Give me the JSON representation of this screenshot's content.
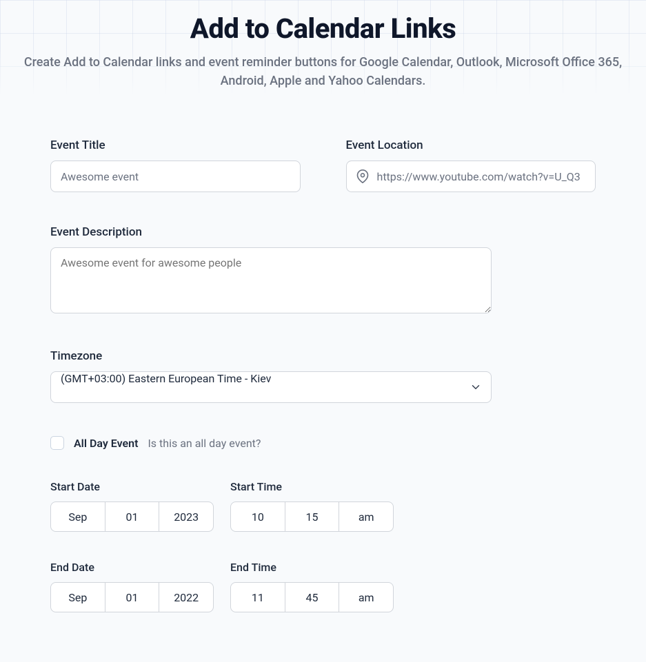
{
  "header": {
    "title": "Add to Calendar Links",
    "subtitle": "Create Add to Calendar links and event reminder buttons for Google Calendar, Outlook, Microsoft Office 365, Android, Apple and Yahoo Calendars."
  },
  "form": {
    "event_title_label": "Event Title",
    "event_title_placeholder": "Awesome event",
    "event_title_value": "",
    "event_location_label": "Event Location",
    "event_location_placeholder": "https://www.youtube.com/watch?v=U_Q3",
    "event_location_value": "",
    "event_description_label": "Event Description",
    "event_description_placeholder": "Awesome event for awesome people",
    "event_description_value": "",
    "timezone_label": "Timezone",
    "timezone_value": "(GMT+03:00) Eastern European Time - Kiev",
    "all_day_label": "All Day Event",
    "all_day_hint": "Is this an all day event?",
    "all_day_checked": false,
    "start_date_label": "Start Date",
    "start_date": {
      "month": "Sep",
      "day": "01",
      "year": "2023"
    },
    "start_time_label": "Start Time",
    "start_time": {
      "hour": "10",
      "minute": "15",
      "ampm": "am"
    },
    "end_date_label": "End Date",
    "end_date": {
      "month": "Sep",
      "day": "01",
      "year": "2022"
    },
    "end_time_label": "End Time",
    "end_time": {
      "hour": "11",
      "minute": "45",
      "ampm": "am"
    }
  }
}
